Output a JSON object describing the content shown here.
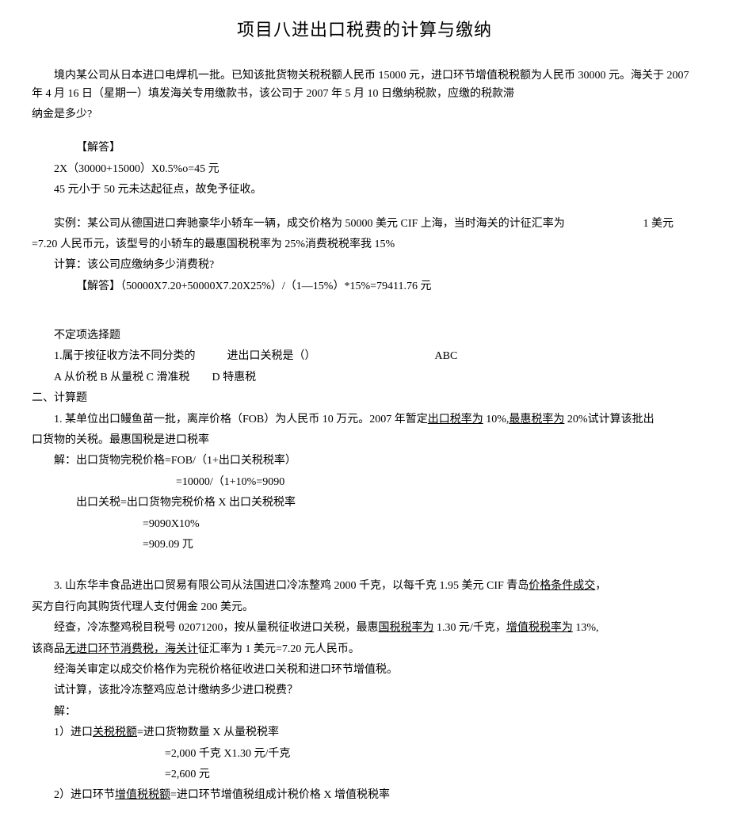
{
  "title": "项目八进出口税费的计算与缴纳",
  "p1": "境内某公司从日本进口电焊机一批。已知该批货物关税税额人民币 15000 元，进口环节增值税税额为人民币 30000 元。海关于 2007 年 4 月 16 日（星期一）填发海关专用缴款书，该公司于 2007 年 5 月 10 日缴纳税款，应缴的税款滞",
  "p1b": "纳金是多少?",
  "ans1_label": "【解答】",
  "ans1_l1": "2X（30000+15000）X0.5%o=45 元",
  "ans1_l2": "45 元小于 50 元未达起征点，故免予征收。",
  "ex2_a": "实例：某公司从德国进口奔驰豪华小轿车一辆，成交价格为 50000 美元 CIF 上海，当时海关的计征汇率为",
  "ex2_a_tail": "1 美元",
  "ex2_b": "=7.20 人民币元，该型号的小轿车的最惠国税税率为 25%消费税税率我 15%",
  "ex2_c": "计算：该公司应缴纳多少消费税?",
  "ex2_ans": "【解答】（50000X7.20+50000X7.20X25%）/（1—15%）*15%=79411.76 元",
  "mc_h": "不定项选择题",
  "mc_q_a": "1.属于按征收方法不同分类的",
  "mc_q_b": "进出口关税是（）",
  "mc_ans": "ABC",
  "mc_opts": "A 从价税 B 从量税 C 滑准税        D 特惠税",
  "sec2": "二、计算题",
  "q1_a": "1. 某单位出口鳗鱼苗一批，离岸价格（FOB）为人民币 10 万元。2007 年暂定",
  "q1_u1": "出口税率为",
  "q1_b": " 10%,",
  "q1_u2": "最惠税率为",
  "q1_c": " 20%试计算该批出",
  "q1_d": "口货物的关税。最惠国税是进口税率",
  "q1_l1": "解：出口货物完税价格=FOB/（1+出口关税税率）",
  "q1_l2": "=10000/（1+10%=9090",
  "q1_l3": "出口关税=出口货物完税价格 X 出口关税税率",
  "q1_l4": "=9090X10%",
  "q1_l5": "=909.09 兀",
  "q3_a": "3. 山东华丰食品进出口贸易有限公司从法国进口冷冻整鸡 2000 千克，以每千克 1.95 美元 CIF 青岛",
  "q3_u1": "价格条件成交",
  "q3_a2": "，",
  "q3_b": "买方自行向其购货代理人支付佣金 200 美元。",
  "q3_c1": "经查，冷冻整鸡税目税号 02071200，按从量税征收进口关税，最惠",
  "q3_u2": "国税税率为",
  "q3_c2": " 1.30 元/千克，",
  "q3_u3": "增值税税率为",
  "q3_c3": " 13%,",
  "q3_d1": "该商品",
  "q3_u4": "无进口环节消费税，海关计",
  "q3_d2": "征汇率为 1 美元=7.20 元人民币。",
  "q3_e": "经海关审定以成交价格作为完税价格征收进口关税和进口环节增值税。",
  "q3_f": "试计算，该批冷冻整鸡应总计缴纳多少进口税费？",
  "q3_g": "解：",
  "q3_h1a": "1）进口",
  "q3_h1u": "关税税额",
  "q3_h1b": "=进口货物数量 X 从量税税率",
  "q3_h2": "=2,000 千克 X1.30 元/千克",
  "q3_h3": "=2,600 元",
  "q3_i1a": "2）进口环节",
  "q3_i1u": "增值税税额",
  "q3_i1b": "=进口环节增值税组成计税价格 X 增值税税率"
}
